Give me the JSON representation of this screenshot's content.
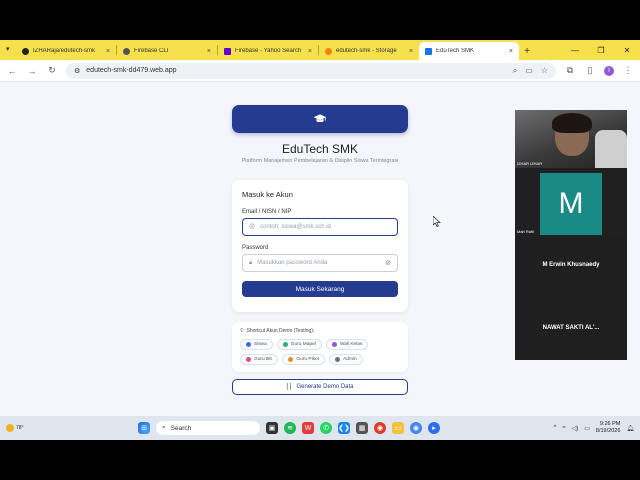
{
  "browser": {
    "tabs": [
      {
        "title": "IZHARaja/edutech-smk",
        "favicon_color": "#222222",
        "active": false
      },
      {
        "title": "Firebase CLI",
        "favicon_color": "#555555",
        "active": false
      },
      {
        "title": "Firebase - Yahoo Search",
        "favicon_color": "#6001d2",
        "active": false
      },
      {
        "title": "edutech-smk - Storage",
        "favicon_color": "#f5820d",
        "active": false
      },
      {
        "title": "EduTech SMK",
        "favicon_color": "#1a73e8",
        "active": true
      }
    ],
    "new_tab": "+",
    "url": "edutech-smk-dd479.web.app",
    "profile_initial": "I"
  },
  "app": {
    "title": "EduTech SMK",
    "subtitle": "Platform Manajemen Pembelajaran & Disiplin Siswa Terintegrasi",
    "login": {
      "heading": "Masuk ke Akun",
      "email_label": "Email / NISN / NIP",
      "email_placeholder": "contoh: siswa@smk.sch.id",
      "password_label": "Password",
      "password_placeholder": "Masukkan password Anda",
      "submit_label": "Masuk Sekarang"
    },
    "shortcuts": {
      "title": "Shortcut Akun Demo (Testing):",
      "items": [
        {
          "label": "Siswa",
          "color": "#3b6fe0"
        },
        {
          "label": "Guru Mapel",
          "color": "#22b573"
        },
        {
          "label": "Wali Kelas",
          "color": "#8e59d9"
        },
        {
          "label": "Guru BK",
          "color": "#e2478f"
        },
        {
          "label": "Guru Piket",
          "color": "#f08a24"
        },
        {
          "label": "Admin",
          "color": "#6b7280"
        }
      ]
    },
    "generate_label": "Generate Demo Data",
    "accent": "#243b8f"
  },
  "call": {
    "cam_name": "IZHAR IZHAR",
    "tile_initial": "M",
    "tile_name": "Mah Rafli",
    "participants": [
      "M Erwin Khusnaedy",
      "NAWAT SAKTI AL'..."
    ]
  },
  "taskbar": {
    "weather": "78°",
    "search": "Search",
    "time": "9:26 PM",
    "date": "8/19/2026"
  }
}
